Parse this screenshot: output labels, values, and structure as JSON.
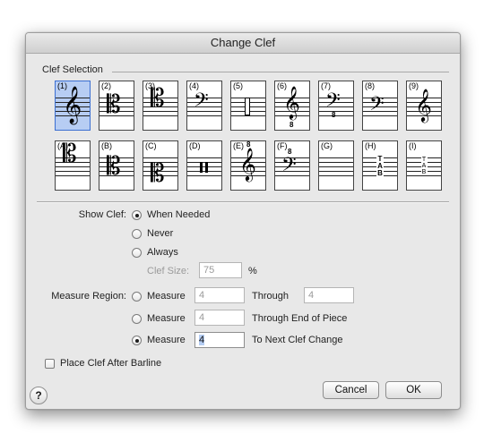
{
  "dialog": {
    "title": "Change Clef"
  },
  "clef_selection": {
    "label": "Clef Selection",
    "selected": "(1)",
    "tiles_row1": [
      "(1)",
      "(2)",
      "(3)",
      "(4)",
      "(5)",
      "(6)",
      "(7)",
      "(8)",
      "(9)"
    ],
    "tiles_row2": [
      "(A)",
      "(B)",
      "(C)",
      "(D)",
      "(E)",
      "(F)",
      "(G)",
      "(H)",
      "(I)"
    ],
    "octave_marks": {
      "six": "8",
      "seven": "8",
      "e": "8",
      "f": "8"
    },
    "tab_letters": {
      "h": [
        "T",
        "A",
        "B"
      ],
      "i": [
        "T",
        "A",
        "B"
      ]
    }
  },
  "show_clef": {
    "label": "Show Clef:",
    "options": [
      "When Needed",
      "Never",
      "Always"
    ],
    "selected": "When Needed",
    "clef_size_label": "Clef Size:",
    "clef_size_value": "75",
    "clef_size_unit": "%"
  },
  "measure_region": {
    "label": "Measure Region:",
    "option_label": "Measure",
    "row1": {
      "from": "4",
      "through_label": "Through",
      "to": "4"
    },
    "row2": {
      "from": "4",
      "suffix": "Through End of Piece"
    },
    "row3": {
      "from": "4",
      "suffix": "To Next Clef Change"
    },
    "selected_row": 3
  },
  "place_after_barline": {
    "label": "Place Clef After Barline",
    "checked": false
  },
  "buttons": {
    "cancel": "Cancel",
    "ok": "OK",
    "help": "?"
  }
}
